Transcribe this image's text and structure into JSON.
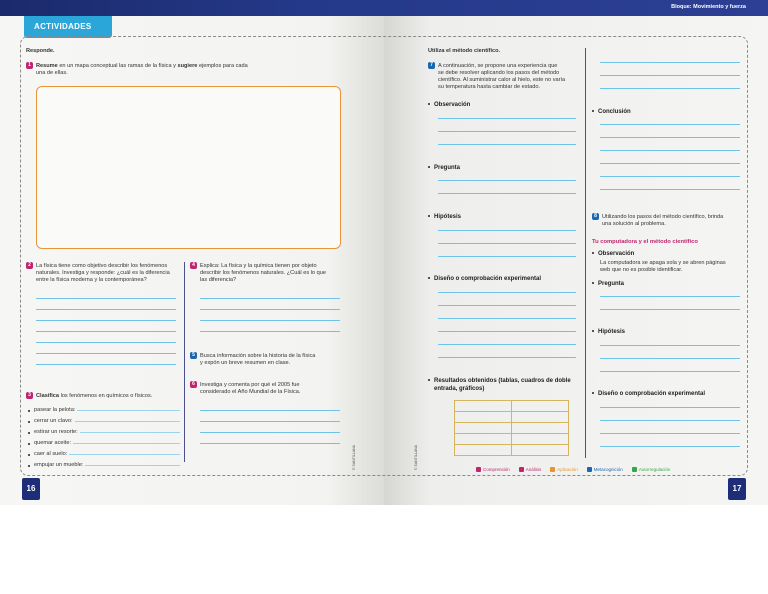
{
  "header": {
    "right_title": "Bloque: Movimiento y fuerza",
    "tab_label": "ACTIVIDADES"
  },
  "left": {
    "responde": "Responde.",
    "q1": {
      "num": "1",
      "verb": "Resume",
      "text_a": " en un mapa conceptual las ramas de la física y ",
      "verb2": "sugiere",
      "text_b": " ejemplos para cada",
      "text_c": "una de ellas."
    },
    "q2": {
      "num": "2",
      "lines": [
        "La física tiene como objetivo describir los fenómenos",
        "naturales. Investiga y responde: ¿cuál es la diferencia",
        "entre la física moderna y la contemporánea?"
      ]
    },
    "q3": {
      "num": "3",
      "verb": "Clasifica",
      "text": " los fenómenos en químicos o físicos.",
      "items": [
        "pasear la pelota:",
        "cerrar un clavo:",
        "estirar un resorte:",
        "quemar aceite:",
        "caer al suelo:",
        "empujar un mueble:"
      ]
    },
    "q4": {
      "num": "4",
      "lines": [
        "Explica: La física y la química tienen por objeto",
        "describir los fenómenos naturales. ¿Cuál es lo que",
        "las diferencia?"
      ]
    },
    "q5": {
      "num": "5",
      "lines": [
        "Busca información sobre la historia de la física",
        "y expón un breve resumen en clase."
      ]
    },
    "q6": {
      "num": "6",
      "lines": [
        "Investiga y comenta por qué el 2005 fue",
        "considerado el Año Mundial de la Física."
      ]
    },
    "copyright": "© SANTILLANA",
    "page_number": "16"
  },
  "right": {
    "utiliza": "Utiliza el método científico.",
    "q7": {
      "num": "7",
      "lines": [
        "A continuación, se propone una experiencia que",
        "se debe resolver aplicando los pasos del método",
        "científico. Al suministrar calor al hielo, este no varía",
        "su temperatura hasta cambiar de estado."
      ]
    },
    "steps": [
      "Observación",
      "Pregunta",
      "Hipótesis",
      "Diseño o comprobación experimental",
      "Resultados obtenidos (tablas, cuadros de doble",
      "entrada, gráficos)"
    ],
    "conclusion": "Conclusión",
    "q8": {
      "num": "8",
      "lines": [
        "Utilizando los pasos del método científico, brinda",
        "una solución al problema."
      ]
    },
    "tu_computadora": "Tu computadora y el método científico",
    "obs_label": "Observación",
    "obs_text": [
      "La computadora se apaga sola y se abren páginas",
      "web que no es posible identificar."
    ],
    "pregunta": "Pregunta",
    "hipotesis": "Hipótesis",
    "diseno": "Diseño o comprobación experimental",
    "legend": [
      {
        "label": "Comprensión",
        "color": "#c0266e"
      },
      {
        "label": "Análisis",
        "color": "#c0266e"
      },
      {
        "label": "Aplicación",
        "color": "#e8962b"
      },
      {
        "label": "Metacognición",
        "color": "#1a66b0"
      },
      {
        "label": "Autorregulación",
        "color": "#3aa64a"
      }
    ],
    "copyright": "© SANTILLANA",
    "page_number": "17"
  }
}
